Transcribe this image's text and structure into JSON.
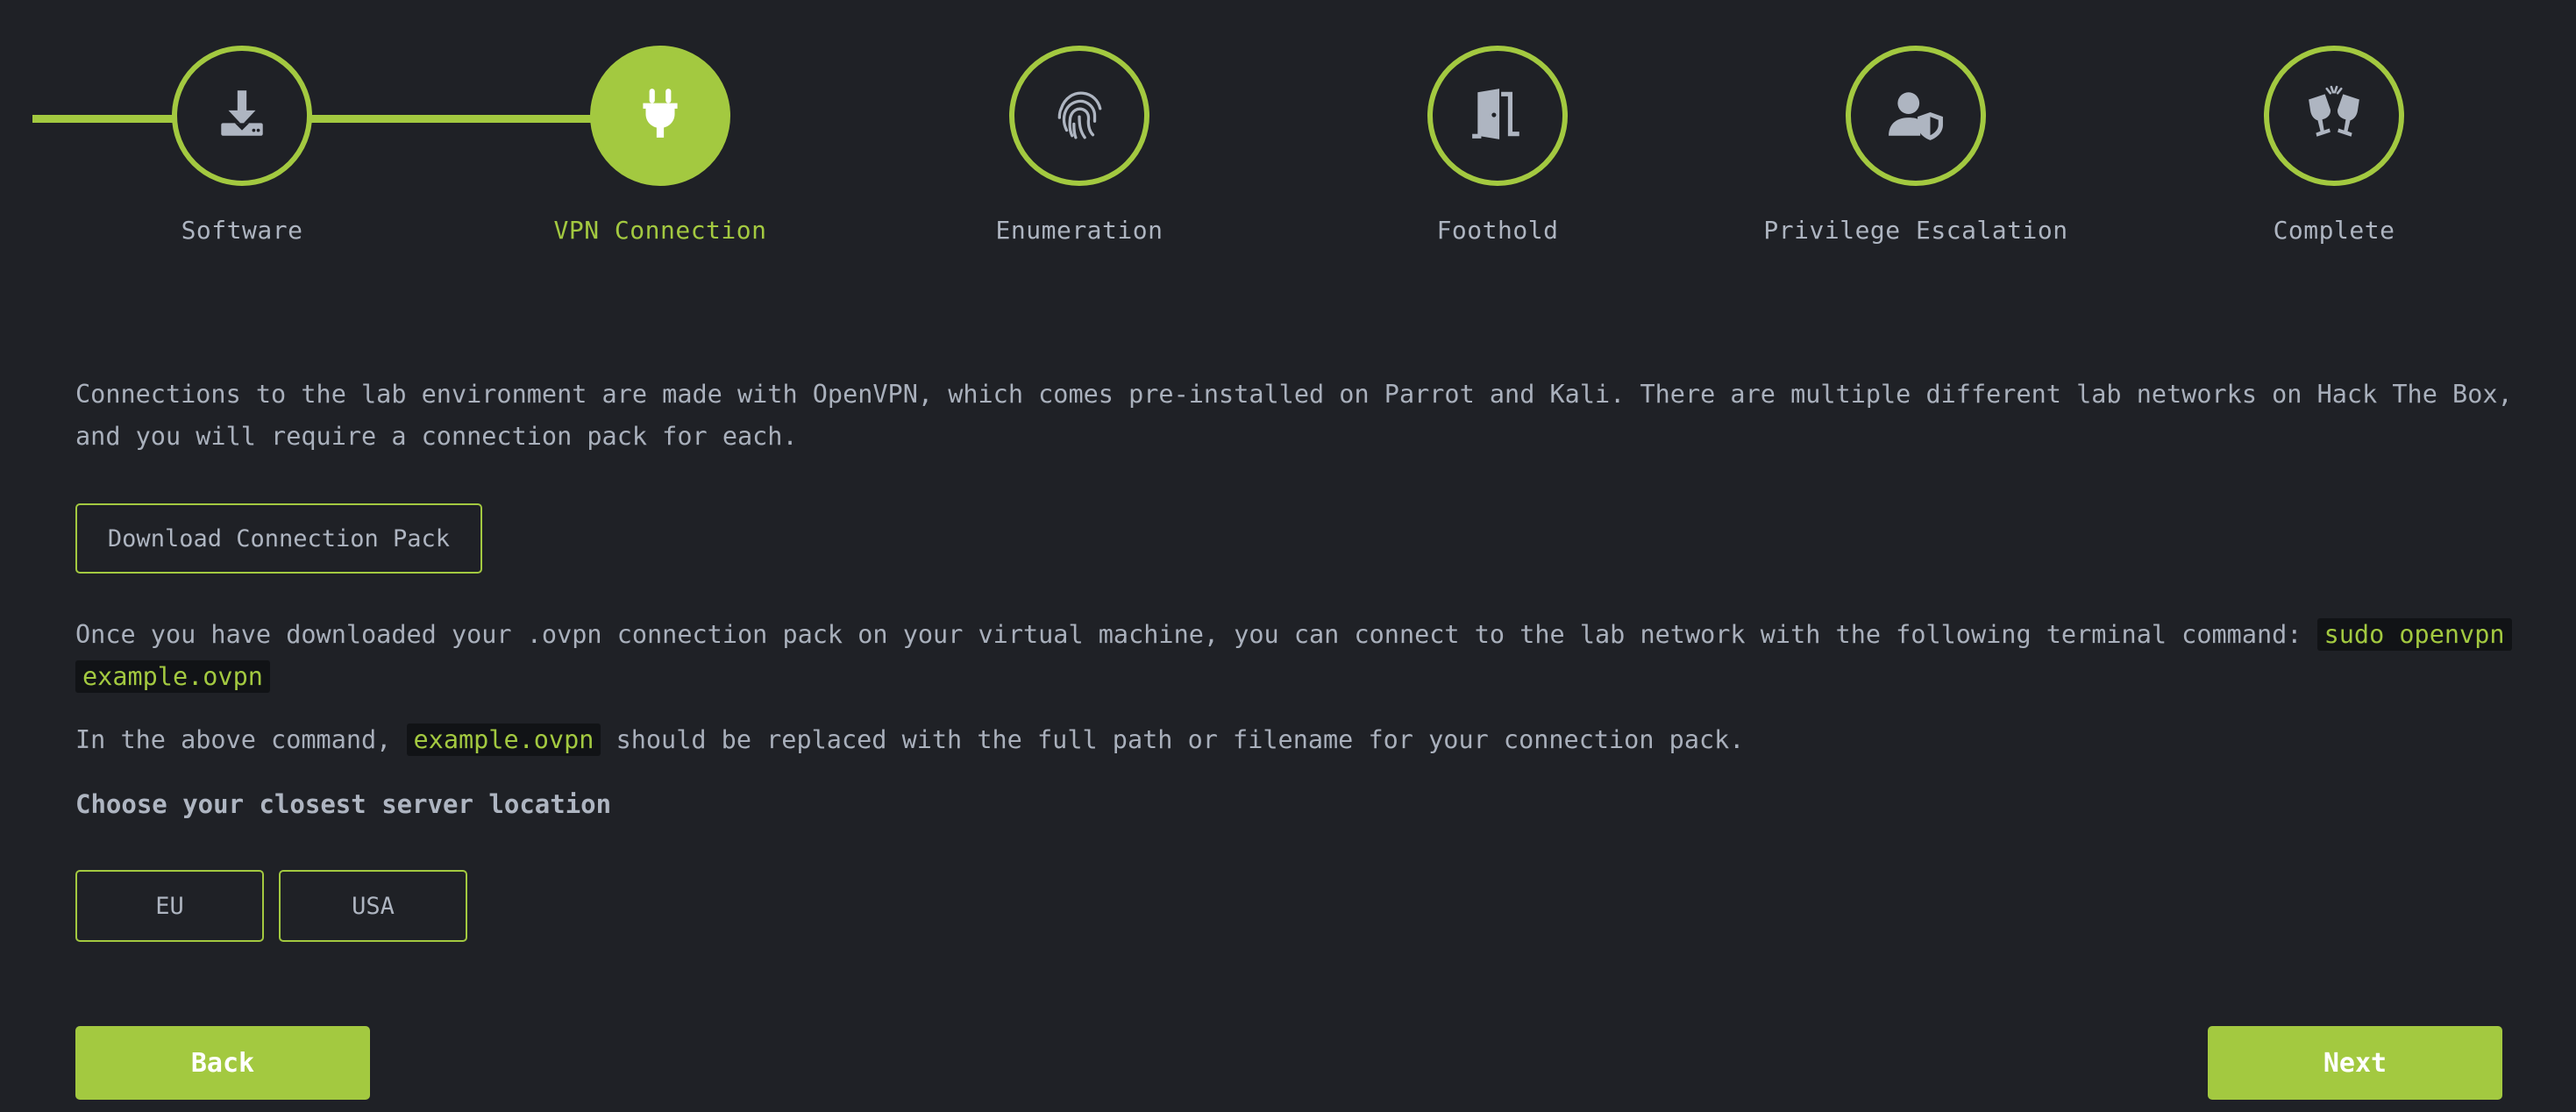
{
  "stepper": {
    "steps": [
      {
        "label": "Software",
        "icon": "download-icon",
        "state": "completed"
      },
      {
        "label": "VPN Connection",
        "icon": "plug-icon",
        "state": "active"
      },
      {
        "label": "Enumeration",
        "icon": "fingerprint-icon",
        "state": "pending"
      },
      {
        "label": "Foothold",
        "icon": "door-open-icon",
        "state": "pending"
      },
      {
        "label": "Privilege Escalation",
        "icon": "user-shield-icon",
        "state": "pending"
      },
      {
        "label": "Complete",
        "icon": "glass-cheers-icon",
        "state": "pending"
      }
    ]
  },
  "intro": {
    "line1": "Connections to the lab environment are made with OpenVPN, which comes pre-installed on Parrot and Kali. There are multiple different lab networks on Hack The Box,",
    "line2": "and you will require a connection pack for each."
  },
  "download_button": "Download Connection Pack",
  "instructions": {
    "line1_text": "Once you have downloaded your .ovpn connection pack on your virtual machine, you can connect to the lab network with the following terminal command: ",
    "command_part1": "sudo openvpn",
    "command_part2": "example.ovpn",
    "line3_prefix": "In the above command, ",
    "line3_code": "example.ovpn",
    "line3_suffix": " should be replaced with the full path or filename for your connection pack."
  },
  "server_heading": "Choose your closest server location",
  "server_options": [
    "EU",
    "USA"
  ],
  "nav": {
    "back": "Back",
    "next": "Next"
  },
  "colors": {
    "accent": "#a3c940",
    "background": "#1f2126",
    "text": "#a9b0bc",
    "icon": "#aeb5c1"
  }
}
